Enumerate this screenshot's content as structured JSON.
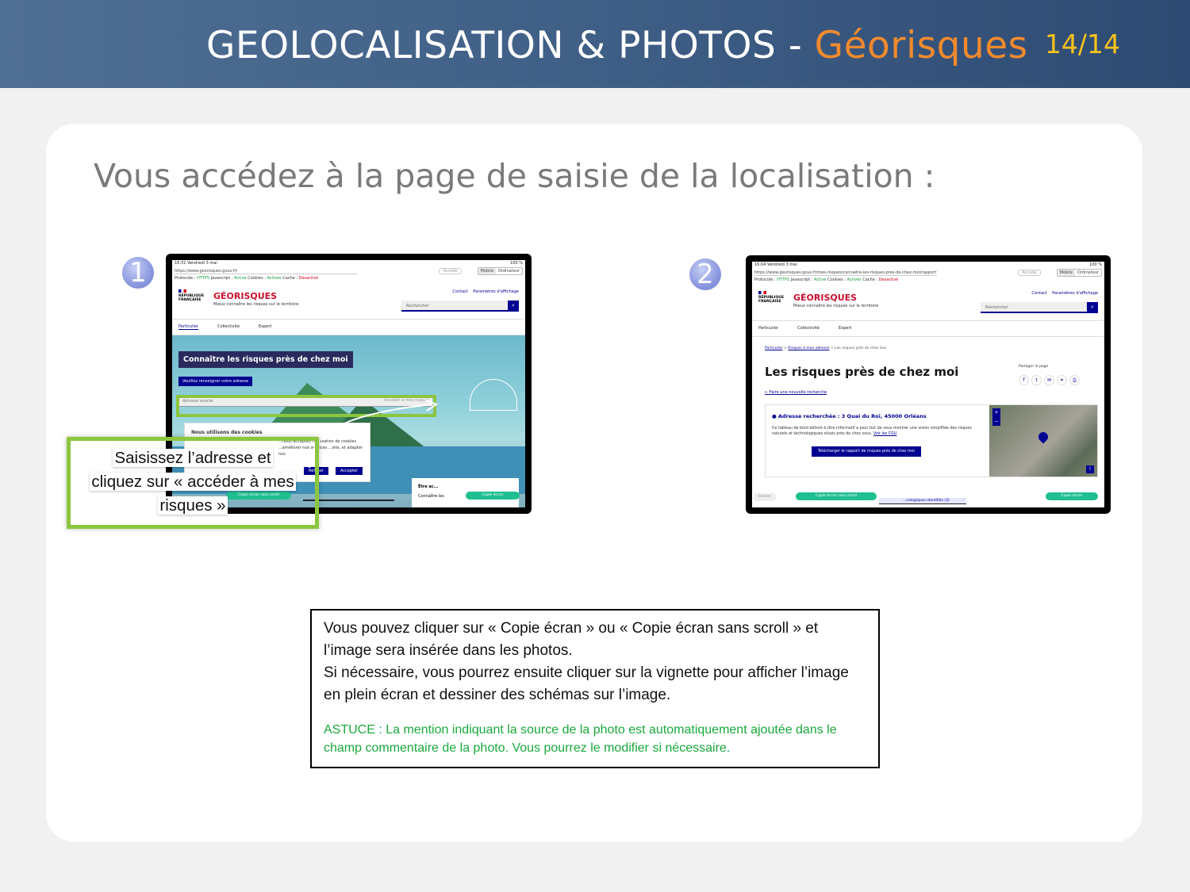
{
  "header": {
    "title_main": "GEOLOCALISATION & PHOTOS - ",
    "title_brand": "Géorisques",
    "page_number": "14/14"
  },
  "subtitle": "Vous accédez à la page de saisie de la localisation :",
  "steps": [
    "1",
    "2"
  ],
  "tablet1": {
    "status_time": "16:31  Vendredi 3 mai",
    "status_battery": "100 %",
    "url": "https://www.georisques.gouv.fr/",
    "url_pill": "Accède",
    "view_mobile": "Mobile",
    "view_desktop": "Ordinateur",
    "protocol": {
      "label": "Protocole :",
      "https": "HTTPS",
      "js_label": "Javascript :",
      "js": "Activé",
      "cookies_label": "Cookies :",
      "cookies": "Activés",
      "cache_label": "Cache :",
      "cache": "Désactivé"
    },
    "brand_rf": "RÉPUBLIQUE FRANÇAISE",
    "logo": "GÉORISQUES",
    "tagline": "Mieux connaître les risques sur le territoire",
    "contact": "Contact",
    "display_settings": "Paramètres d'affichage",
    "search_placeholder": "Rechercher",
    "nav": [
      "Particulier",
      "Collectivité",
      "Expert"
    ],
    "hero_title": "Connaître les risques près de chez moi",
    "hero_sub": "Veuillez renseigner votre adresse",
    "address_placeholder": "Adresse exacte",
    "address_button": "Accéder à mes risques",
    "cookie_title": "Nous utilisons des cookies",
    "cookie_text": "...nous acceptez l'utilisation de cookies ...améliorer nos services ...site, et adapter nos",
    "cookie_refuse": "Refuser",
    "cookie_accept": "Accepter",
    "btn_copy_noscroll": "Copie écran sans scroll",
    "btn_copy": "Copie écran",
    "card_text": "Être ac...",
    "card_sub": "Connaître les"
  },
  "tablet2": {
    "status_time": "16:04  Vendredi 3 mai",
    "status_battery": "100 %",
    "url": "https://www.georisques.gouv.fr/mes-risques/connaitre-les-risques-pres-de-chez-moi/rapport?form-adresse=true&isCadastre=false&city=Orl...",
    "crumb1": "Particulier",
    "crumb2": "Risques à mon adresse",
    "crumb3": "Les risques près de chez moi",
    "title": "Les risques près de chez moi",
    "share_label": "Partager la page",
    "new_search": "Faire une nouvelle recherche",
    "address_heading": "Adresse recherchée : 3 Quai du Roi, 45000 Orléans",
    "address_text": "Ce tableau de bord délivré à titre informatif a pour but de vous montrer une vision simplifiée des risques naturels et technologiques situés près de chez vous.",
    "cgu_link": "Voir les CGU",
    "download": "Télécharger le rapport de risques près de chez moi",
    "btn_close": "Fermer",
    "btn_copy_noscroll": "Copie écran sans scroll",
    "btn_copy": "Copie écran",
    "risks_label": "...nologiques identifiés (3)"
  },
  "callout": {
    "line1": "Saisissez l’adresse et",
    "line2": "cliquez sur « accéder à mes",
    "line3": "risques »"
  },
  "info": {
    "text": "Vous pouvez cliquer sur « Copie écran » ou « Copie écran sans scroll » et l’image sera insérée dans les photos.\nSi nécessaire, vous pourrez ensuite cliquer sur la vignette pour afficher l’image en plein écran et dessiner des schémas sur l’image.",
    "tip": "ASTUCE : La mention indiquant la source de la photo est automatiquement ajoutée dans le champ commentaire de la photo. Vous pourrez le modifier si nécessaire."
  },
  "colors": {
    "header_bg": "#3f5f86",
    "brand_orange": "#f28a2d",
    "page_number": "#f7c21b",
    "highlight_green": "#8cc63f",
    "tip_green": "#1aa83c",
    "dsfr_blue": "#000091"
  }
}
